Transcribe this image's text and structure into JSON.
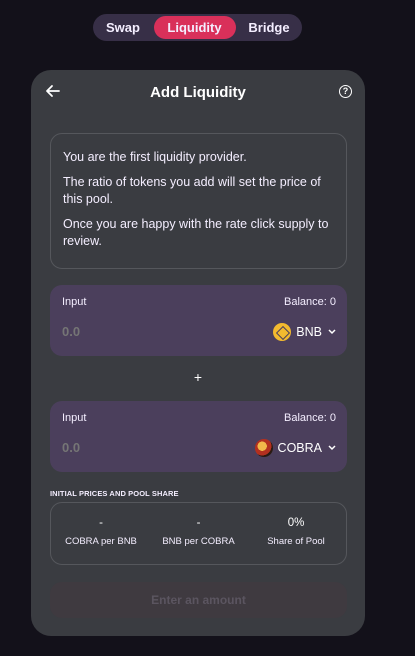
{
  "nav": {
    "swap": "Swap",
    "liquidity": "Liquidity",
    "bridge": "Bridge"
  },
  "header": {
    "title": "Add Liquidity",
    "help": "?"
  },
  "info": {
    "line1": "You are the first liquidity provider.",
    "line2": "The ratio of tokens you add will set the price of this pool.",
    "line3": "Once you are happy with the rate click supply to review."
  },
  "input_a": {
    "label": "Input",
    "balance": "Balance: 0",
    "amount_placeholder": "0.0",
    "token": "BNB",
    "icon": "bnb-icon"
  },
  "plus": "+",
  "input_b": {
    "label": "Input",
    "balance": "Balance: 0",
    "amount_placeholder": "0.0",
    "token": "COBRA",
    "icon": "cobra-icon"
  },
  "prices": {
    "heading": "INITIAL PRICES AND POOL SHARE",
    "items": [
      {
        "value": "-",
        "label": "COBRA per BNB"
      },
      {
        "value": "-",
        "label": "BNB per COBRA"
      },
      {
        "value": "0%",
        "label": "Share of Pool"
      }
    ]
  },
  "submit_label": "Enter an amount",
  "colors": {
    "accent": "#d9305a",
    "card": "#3a3c41",
    "input_panel": "#4b3f5c",
    "background": "#13111a"
  }
}
